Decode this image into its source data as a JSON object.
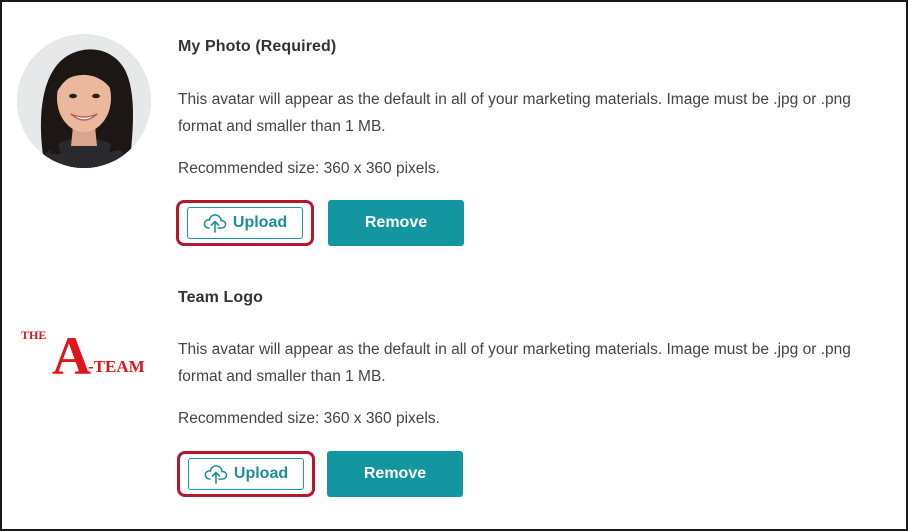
{
  "photo_section": {
    "title": "My Photo  (Required)",
    "description": "This avatar will appear as the default in all of your marketing materials. Image must be .jpg or .png format and smaller than 1 MB.",
    "recommended": "Recommended size: 360 x 360 pixels.",
    "upload_label": "Upload",
    "remove_label": "Remove"
  },
  "logo_section": {
    "title": "Team Logo",
    "logo_text_top": "THE",
    "logo_text_letter": "A",
    "logo_text_right": "-TEAM",
    "description": "This avatar will appear as the default in all of your marketing materials. Image must be .jpg or .png format and smaller than 1 MB.",
    "recommended": "Recommended size: 360 x 360 pixels.",
    "upload_label": "Upload",
    "remove_label": "Remove"
  },
  "colors": {
    "accent": "#13969f",
    "highlight": "#b5172f",
    "logo_red": "#e0141c"
  },
  "icons": {
    "upload": "cloud-upload-icon"
  }
}
